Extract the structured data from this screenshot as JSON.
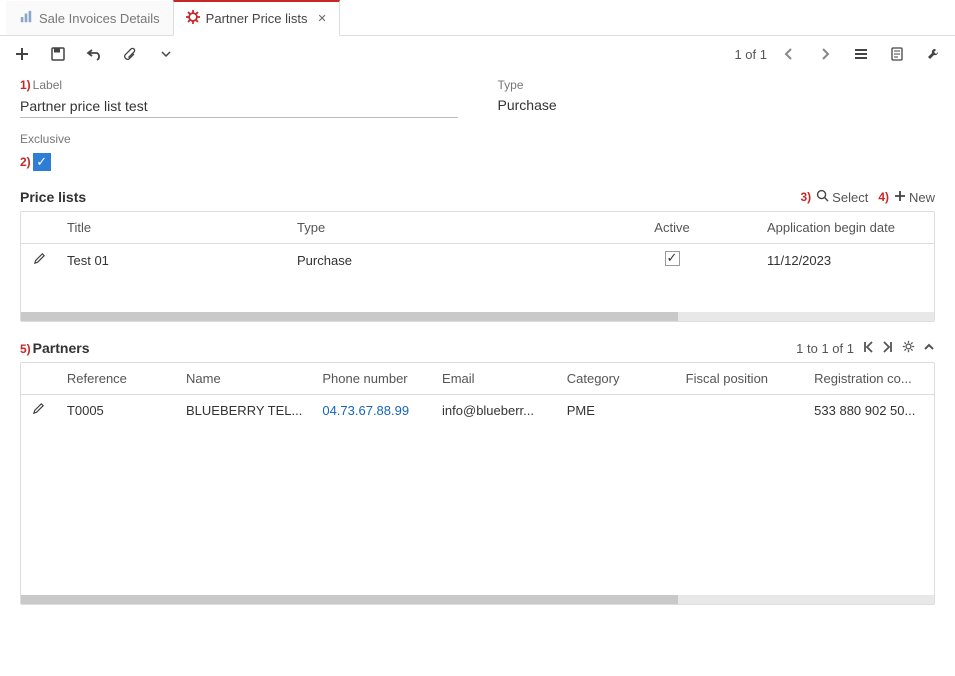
{
  "tabs": {
    "t0": {
      "label": "Sale Invoices Details"
    },
    "t1": {
      "label": "Partner Price lists"
    }
  },
  "toolbar": {
    "counter": "1 of 1"
  },
  "markers": {
    "m1": "1)",
    "m2": "2)",
    "m3": "3)",
    "m4": "4)",
    "m5": "5)"
  },
  "form": {
    "label_caption": "Label",
    "label_value": "Partner price list test",
    "type_caption": "Type",
    "type_value": "Purchase",
    "exclusive_caption": "Exclusive"
  },
  "price_panel": {
    "title": "Price lists",
    "select_label": "Select",
    "new_label": "New",
    "cols": {
      "title": "Title",
      "type": "Type",
      "active": "Active",
      "begin": "Application begin date"
    },
    "row0": {
      "title": "Test 01",
      "type": "Purchase",
      "begin": "11/12/2023"
    }
  },
  "partners_panel": {
    "title": "Partners",
    "counter": "1 to 1 of 1",
    "cols": {
      "ref": "Reference",
      "name": "Name",
      "phone": "Phone number",
      "email": "Email",
      "category": "Category",
      "fiscal": "Fiscal position",
      "regco": "Registration co..."
    },
    "row0": {
      "ref": "T0005",
      "name": "BLUEBERRY TEL...",
      "phone": "04.73.67.88.99",
      "email": "info@blueberr...",
      "category": "PME",
      "fiscal": "",
      "regco": "533 880 902 50..."
    }
  }
}
